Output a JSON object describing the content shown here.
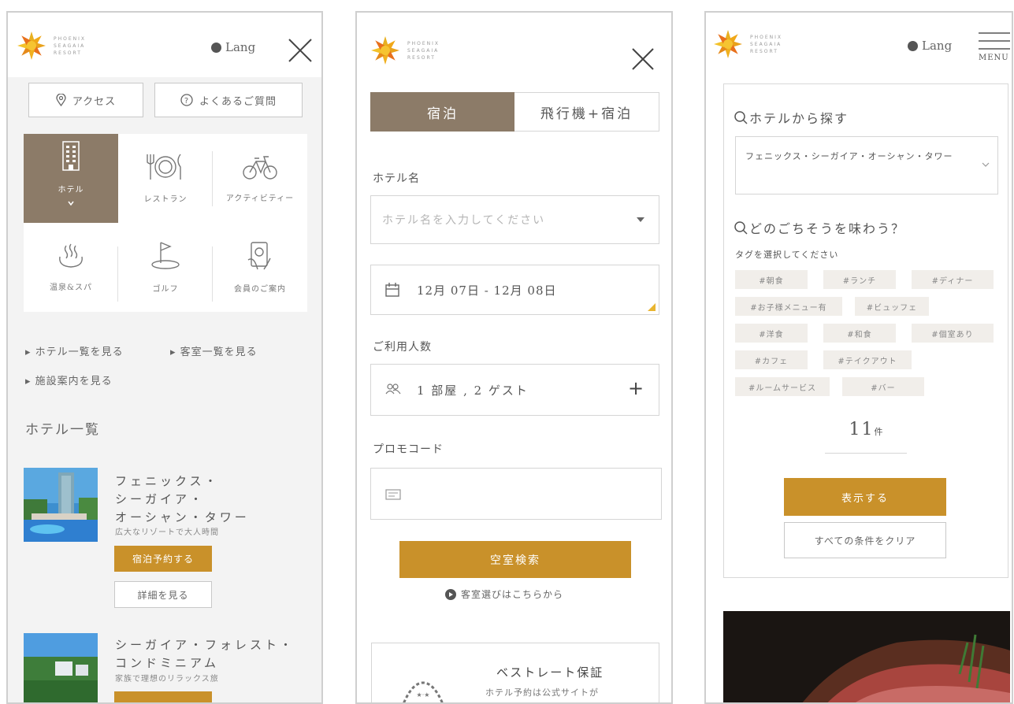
{
  "brand": {
    "logo_text": "PHOENIX\nSEAGAIA\nRESORT"
  },
  "colors": {
    "accent": "#c9912a",
    "taupe": "#8c7b68",
    "text": "#555555",
    "border": "#cfcfcf"
  },
  "panel1": {
    "lang": "Lang",
    "access_label": "アクセス",
    "faq_label": "よくあるご質問",
    "categories": [
      {
        "label": "ホテル",
        "icon": "hotel-building-icon",
        "active": true
      },
      {
        "label": "レストラン",
        "icon": "dining-icon"
      },
      {
        "label": "アクティビティー",
        "icon": "bicycle-icon"
      },
      {
        "label": "温泉&スパ",
        "icon": "onsen-icon"
      },
      {
        "label": "ゴルフ",
        "icon": "golf-flag-icon"
      },
      {
        "label": "会員のご案内",
        "icon": "member-card-icon"
      }
    ],
    "links": [
      "ホテル一覧を見る",
      "客室一覧を見る",
      "施設案内を見る"
    ],
    "section_title": "ホテル一覧",
    "hotels": [
      {
        "name_lines": [
          "フェニックス・",
          "シーガイア・",
          "オーシャン・タワー"
        ],
        "desc": "広大なリゾートで大人時間",
        "book_label": "宿泊予約する",
        "detail_label": "詳細を見る"
      },
      {
        "name_lines": [
          "シーガイア・フォレスト・",
          "コンドミニアム"
        ],
        "desc": "家族で理想のリラックス旅"
      }
    ]
  },
  "panel2": {
    "tabs": [
      "宿泊",
      "飛行機+宿泊"
    ],
    "hotel_name_label": "ホテル名",
    "hotel_name_placeholder": "ホテル名を入力してください",
    "date_value": "12月 07日 - 12月 08日",
    "guests_label": "ご利用人数",
    "guests_value": "1 部屋 , 2 ゲスト",
    "plus": "+",
    "promo_label": "プロモコード",
    "search_button": "空室検索",
    "room_choice_link": "客室選びはこちらから",
    "best_rate_title": "ベストレート保証",
    "best_rate_desc": "ホテル予約は公式サイトが"
  },
  "panel3": {
    "lang": "Lang",
    "menu": "MENU",
    "search_hotel_title": "ホテルから探す",
    "hotel_select_value": "フェニックス・シーガイア・オーシャン・タワー",
    "cuisine_title": "どのごちそうを味わう？",
    "tag_prompt": "タグを選択してください",
    "tags": [
      "#朝食",
      "#ランチ",
      "#ディナー",
      "#お子様メニュー有",
      "#ビュッフェ",
      "#洋食",
      "#和食",
      "#個室あり",
      "#カフェ",
      "#テイクアウト",
      "#ルームサービス",
      "#バー"
    ],
    "count": "11",
    "count_unit": "件",
    "show_button": "表示する",
    "clear_button": "すべての条件をクリア"
  }
}
